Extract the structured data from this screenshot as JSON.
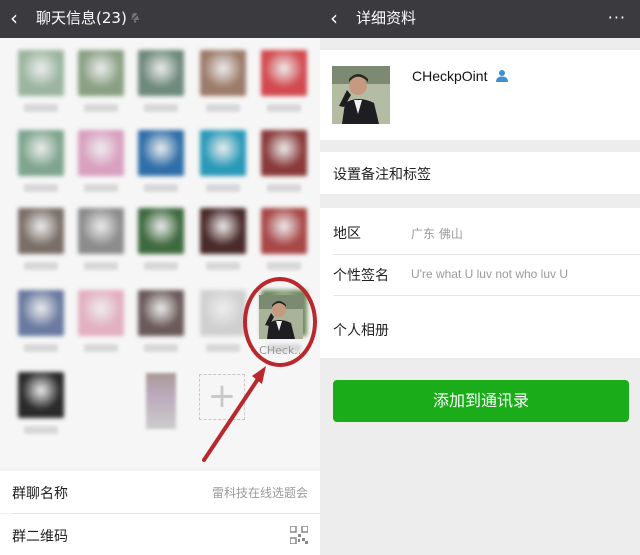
{
  "left": {
    "back_icon": "‹",
    "title": "聊天信息(23)",
    "mute_icon": "bell-muted-icon",
    "members": [
      {
        "color": "#9bb5a0"
      },
      {
        "color": "#8aa084"
      },
      {
        "color": "#6e8a7c"
      },
      {
        "color": "#9c7c6a"
      },
      {
        "color": "#d24a4f"
      },
      {
        "color": "#7fa58f"
      },
      {
        "color": "#d9a0bf"
      },
      {
        "color": "#2f6fa8"
      },
      {
        "color": "#2a9ab8"
      },
      {
        "color": "#8a3a3a"
      },
      {
        "color": "#7a6f68"
      },
      {
        "color": "#8c8c8c"
      },
      {
        "color": "#3f6a3f"
      },
      {
        "color": "#4a2a2a"
      },
      {
        "color": "#a84848"
      },
      {
        "color": "#6a7aa0"
      },
      {
        "color": "#e2b0c0"
      },
      {
        "color": "#6a5a5a"
      },
      {
        "color": "#d0d0d0"
      },
      {
        "color": "#6e8a5a"
      },
      {
        "color": "#2a2a2a"
      }
    ],
    "highlighted_member_name": "CHeck...",
    "add_icon": "+",
    "group_name_label": "群聊名称",
    "group_name_value": "雷科技在线选题会",
    "group_qr_label": "群二维码",
    "qr_icon": "qr-code-icon",
    "accent": "#b8282c"
  },
  "right": {
    "back_icon": "‹",
    "title": "详细资料",
    "more_icon": "···",
    "profile_name": "CHeckpOint",
    "contact_icon": "person-icon",
    "remark_label": "设置备注和标签",
    "region_label": "地区",
    "region_value": "广东  佛山",
    "signature_label": "个性签名",
    "signature_value": "U're what U luv not who luv U",
    "album_label": "个人相册",
    "add_button": "添加到通讯录",
    "button_color": "#1aad19"
  }
}
